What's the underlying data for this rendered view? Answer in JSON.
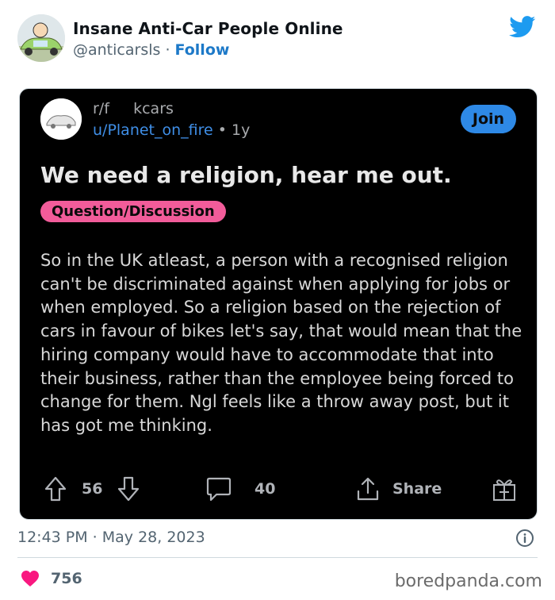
{
  "tweet": {
    "display_name": "Insane Anti-Car People Online",
    "handle": "@anticarsls",
    "separator": " · ",
    "follow_label": "Follow",
    "timestamp": "12:43 PM · May 28, 2023",
    "likes": "756",
    "brand_color": "#1d9bf0",
    "like_color": "#f91880"
  },
  "reddit_post": {
    "subreddit": "r/f     kcars",
    "username": "u/Planet_on_fire",
    "age": " • 1y",
    "join_label": "Join",
    "title": "We need a religion, hear me out.",
    "flair": "Question/Discussion",
    "body": "So in the UK atleast, a person with a recognised religion can't be discriminated against when applying for jobs or when employed. So a religion based on the rejection of cars in favour of bikes let's say, that would mean that the hiring company would have to accommodate that into their business, rather than the employee being forced to change for them. Ngl feels like a throw away post, but it has got me thinking.",
    "upvotes": "56",
    "comments": "40",
    "share_label": "Share",
    "join_color": "#2e89e6",
    "flair_color": "#f25c9a"
  },
  "watermark": "boredpanda.com"
}
